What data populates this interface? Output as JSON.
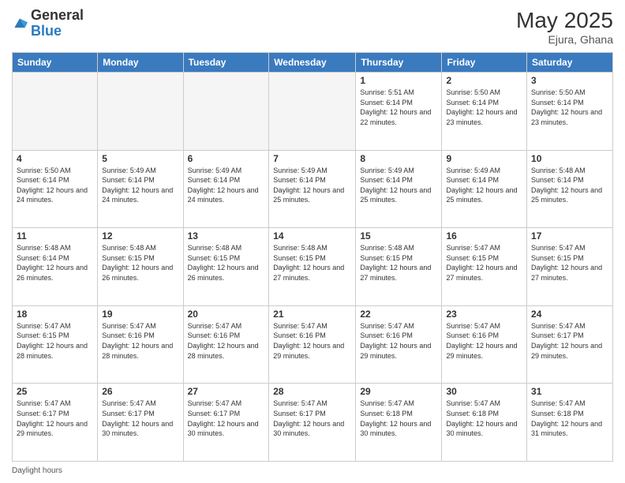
{
  "header": {
    "logo_general": "General",
    "logo_blue": "Blue",
    "month_title": "May 2025",
    "location": "Ejura, Ghana"
  },
  "columns": [
    "Sunday",
    "Monday",
    "Tuesday",
    "Wednesday",
    "Thursday",
    "Friday",
    "Saturday"
  ],
  "weeks": [
    [
      {
        "day": "",
        "info": ""
      },
      {
        "day": "",
        "info": ""
      },
      {
        "day": "",
        "info": ""
      },
      {
        "day": "",
        "info": ""
      },
      {
        "day": "1",
        "info": "Sunrise: 5:51 AM\nSunset: 6:14 PM\nDaylight: 12 hours\nand 22 minutes."
      },
      {
        "day": "2",
        "info": "Sunrise: 5:50 AM\nSunset: 6:14 PM\nDaylight: 12 hours\nand 23 minutes."
      },
      {
        "day": "3",
        "info": "Sunrise: 5:50 AM\nSunset: 6:14 PM\nDaylight: 12 hours\nand 23 minutes."
      }
    ],
    [
      {
        "day": "4",
        "info": "Sunrise: 5:50 AM\nSunset: 6:14 PM\nDaylight: 12 hours\nand 24 minutes."
      },
      {
        "day": "5",
        "info": "Sunrise: 5:49 AM\nSunset: 6:14 PM\nDaylight: 12 hours\nand 24 minutes."
      },
      {
        "day": "6",
        "info": "Sunrise: 5:49 AM\nSunset: 6:14 PM\nDaylight: 12 hours\nand 24 minutes."
      },
      {
        "day": "7",
        "info": "Sunrise: 5:49 AM\nSunset: 6:14 PM\nDaylight: 12 hours\nand 25 minutes."
      },
      {
        "day": "8",
        "info": "Sunrise: 5:49 AM\nSunset: 6:14 PM\nDaylight: 12 hours\nand 25 minutes."
      },
      {
        "day": "9",
        "info": "Sunrise: 5:49 AM\nSunset: 6:14 PM\nDaylight: 12 hours\nand 25 minutes."
      },
      {
        "day": "10",
        "info": "Sunrise: 5:48 AM\nSunset: 6:14 PM\nDaylight: 12 hours\nand 25 minutes."
      }
    ],
    [
      {
        "day": "11",
        "info": "Sunrise: 5:48 AM\nSunset: 6:14 PM\nDaylight: 12 hours\nand 26 minutes."
      },
      {
        "day": "12",
        "info": "Sunrise: 5:48 AM\nSunset: 6:15 PM\nDaylight: 12 hours\nand 26 minutes."
      },
      {
        "day": "13",
        "info": "Sunrise: 5:48 AM\nSunset: 6:15 PM\nDaylight: 12 hours\nand 26 minutes."
      },
      {
        "day": "14",
        "info": "Sunrise: 5:48 AM\nSunset: 6:15 PM\nDaylight: 12 hours\nand 27 minutes."
      },
      {
        "day": "15",
        "info": "Sunrise: 5:48 AM\nSunset: 6:15 PM\nDaylight: 12 hours\nand 27 minutes."
      },
      {
        "day": "16",
        "info": "Sunrise: 5:47 AM\nSunset: 6:15 PM\nDaylight: 12 hours\nand 27 minutes."
      },
      {
        "day": "17",
        "info": "Sunrise: 5:47 AM\nSunset: 6:15 PM\nDaylight: 12 hours\nand 27 minutes."
      }
    ],
    [
      {
        "day": "18",
        "info": "Sunrise: 5:47 AM\nSunset: 6:15 PM\nDaylight: 12 hours\nand 28 minutes."
      },
      {
        "day": "19",
        "info": "Sunrise: 5:47 AM\nSunset: 6:16 PM\nDaylight: 12 hours\nand 28 minutes."
      },
      {
        "day": "20",
        "info": "Sunrise: 5:47 AM\nSunset: 6:16 PM\nDaylight: 12 hours\nand 28 minutes."
      },
      {
        "day": "21",
        "info": "Sunrise: 5:47 AM\nSunset: 6:16 PM\nDaylight: 12 hours\nand 29 minutes."
      },
      {
        "day": "22",
        "info": "Sunrise: 5:47 AM\nSunset: 6:16 PM\nDaylight: 12 hours\nand 29 minutes."
      },
      {
        "day": "23",
        "info": "Sunrise: 5:47 AM\nSunset: 6:16 PM\nDaylight: 12 hours\nand 29 minutes."
      },
      {
        "day": "24",
        "info": "Sunrise: 5:47 AM\nSunset: 6:17 PM\nDaylight: 12 hours\nand 29 minutes."
      }
    ],
    [
      {
        "day": "25",
        "info": "Sunrise: 5:47 AM\nSunset: 6:17 PM\nDaylight: 12 hours\nand 29 minutes."
      },
      {
        "day": "26",
        "info": "Sunrise: 5:47 AM\nSunset: 6:17 PM\nDaylight: 12 hours\nand 30 minutes."
      },
      {
        "day": "27",
        "info": "Sunrise: 5:47 AM\nSunset: 6:17 PM\nDaylight: 12 hours\nand 30 minutes."
      },
      {
        "day": "28",
        "info": "Sunrise: 5:47 AM\nSunset: 6:17 PM\nDaylight: 12 hours\nand 30 minutes."
      },
      {
        "day": "29",
        "info": "Sunrise: 5:47 AM\nSunset: 6:18 PM\nDaylight: 12 hours\nand 30 minutes."
      },
      {
        "day": "30",
        "info": "Sunrise: 5:47 AM\nSunset: 6:18 PM\nDaylight: 12 hours\nand 30 minutes."
      },
      {
        "day": "31",
        "info": "Sunrise: 5:47 AM\nSunset: 6:18 PM\nDaylight: 12 hours\nand 31 minutes."
      }
    ]
  ],
  "footer": {
    "text": "Daylight hours"
  }
}
